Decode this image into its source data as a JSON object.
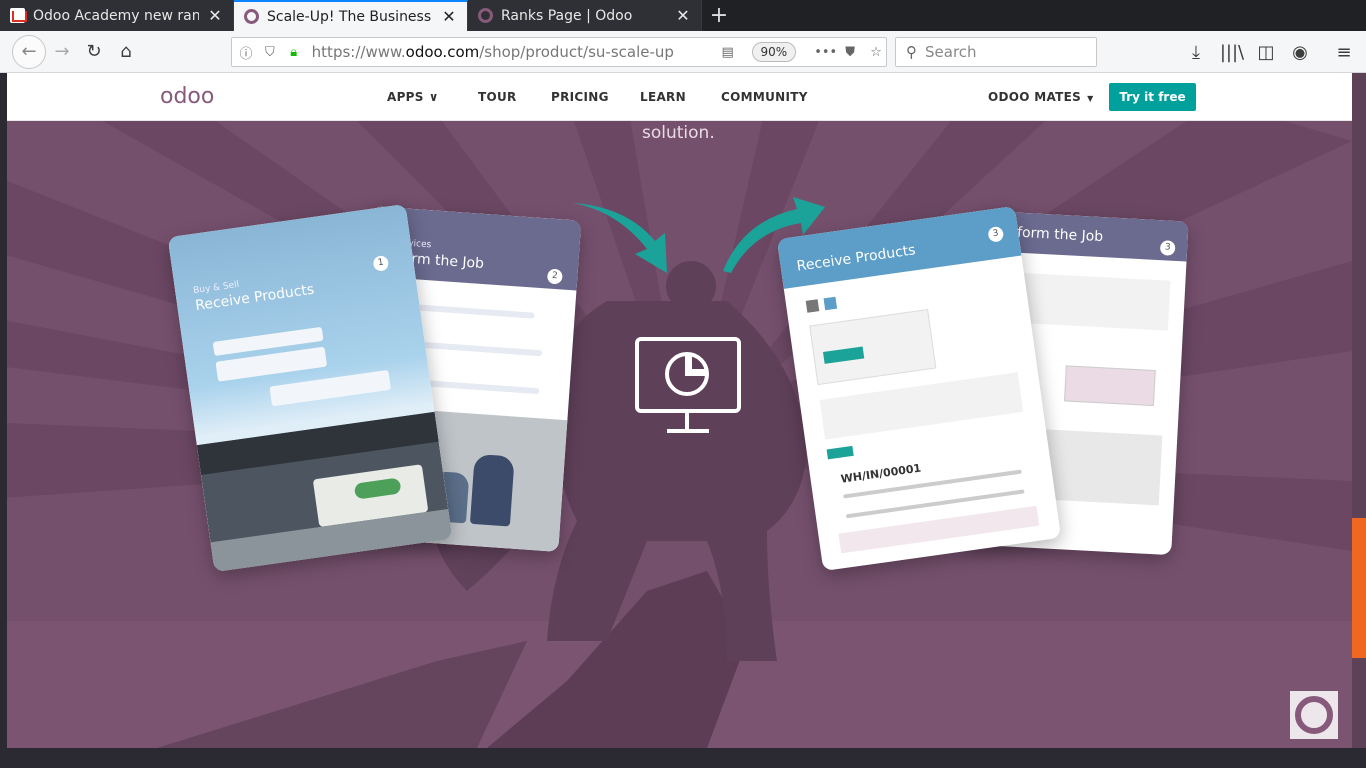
{
  "browser": {
    "tabs": [
      {
        "title": "Odoo Academy new ran",
        "favicon": "gmail-icon",
        "active": false
      },
      {
        "title": "Scale-Up! The Business G",
        "favicon": "odoo-icon",
        "active": true
      },
      {
        "title": "Ranks Page | Odoo",
        "favicon": "odoo-icon",
        "active": false
      }
    ],
    "url_prefix": "https://www.",
    "url_domain": "odoo.com",
    "url_path": "/shop/product/su-scale-up",
    "zoom": "90%",
    "search_placeholder": "Search"
  },
  "site": {
    "logo": "odoo",
    "menu": {
      "apps": "APPS",
      "tour": "TOUR",
      "pricing": "PRICING",
      "learn": "LEARN",
      "community": "COMMUNITY"
    },
    "account": "ODOO MATES",
    "cta": "Try it free",
    "accent": "#00a09d",
    "brand": "#875a7b"
  },
  "hero": {
    "subtitle": "solution.",
    "background": "#75506d",
    "card_left_back": {
      "title": "rform the Job",
      "small": "Services",
      "number": "2"
    },
    "card_left_front": {
      "title": "Receive Products",
      "small": "Buy & Sell",
      "number": "1"
    },
    "card_right_front": {
      "title": "Receive Products",
      "number": "3",
      "ref": "WH/IN/00001"
    },
    "card_right_back": {
      "title": "erform the Job",
      "number": "3"
    }
  }
}
